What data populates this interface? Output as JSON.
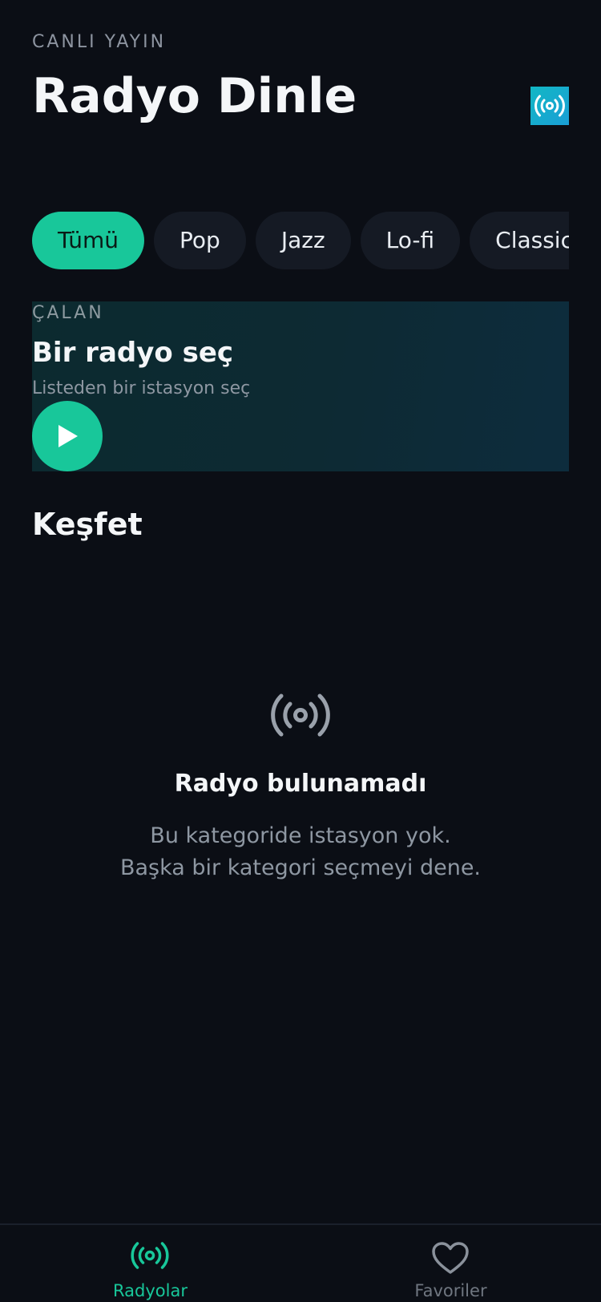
{
  "header": {
    "eyebrow": "CANLI YAYIN",
    "title": "Radyo Dinle",
    "live_icon": "radio-broadcast-icon"
  },
  "categories": [
    {
      "label": "Tümü",
      "active": true
    },
    {
      "label": "Pop",
      "active": false
    },
    {
      "label": "Jazz",
      "active": false
    },
    {
      "label": "Lo-fi",
      "active": false
    },
    {
      "label": "Classic",
      "active": false
    }
  ],
  "now_playing": {
    "label": "ÇALAN",
    "title": "Bir radyo seç",
    "subtitle": "Listeden bir istasyon seç",
    "play_icon": "play-icon"
  },
  "discover": {
    "title": "Keşfet"
  },
  "empty_state": {
    "icon": "radio-broadcast-icon",
    "title": "Radyo bulunamadı",
    "line1": "Bu kategoride istasyon yok.",
    "line2": "Başka bir kategori seçmeyi dene."
  },
  "tabbar": {
    "radios": {
      "label": "Radyolar",
      "icon": "radio-broadcast-icon"
    },
    "favorites": {
      "label": "Favoriler",
      "icon": "heart-icon"
    }
  },
  "colors": {
    "background": "#0b0e15",
    "accent": "#18c79a",
    "chip": "#151a24",
    "muted_text": "#8e97a2"
  }
}
